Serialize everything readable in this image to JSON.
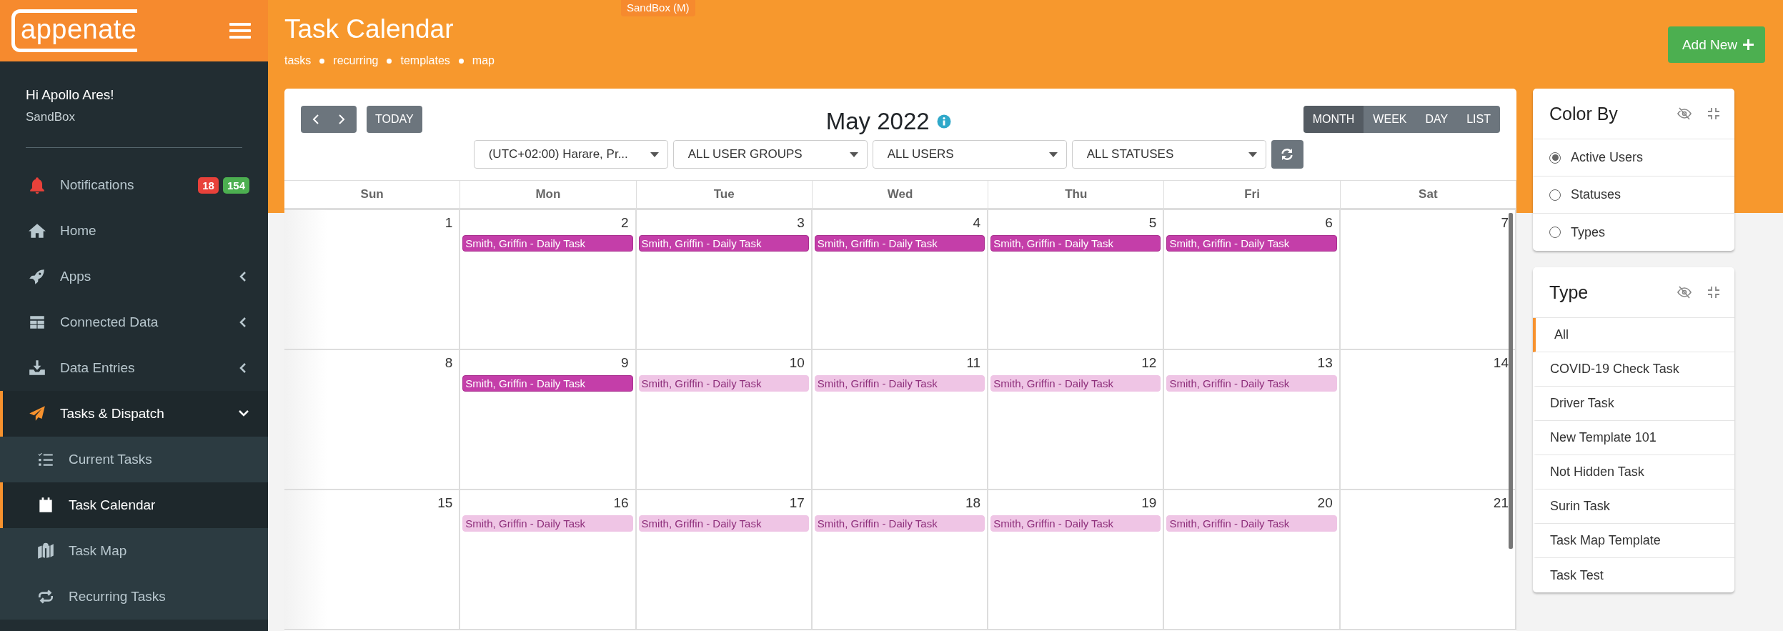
{
  "sandbox_badge": "SandBox (M)",
  "sidebar": {
    "logo": "appenate",
    "greeting": "Hi Apollo Ares!",
    "account": "SandBox",
    "items": [
      {
        "kind": "link",
        "label": "Notifications",
        "selected": false,
        "badges": [
          {
            "text": "18",
            "color": "#e8413a"
          },
          {
            "text": "154",
            "color": "#4caf50"
          }
        ]
      },
      {
        "kind": "link",
        "label": "Home",
        "selected": false
      },
      {
        "kind": "group",
        "label": "Apps",
        "selected": false,
        "expanded": false
      },
      {
        "kind": "group",
        "label": "Connected Data",
        "selected": false,
        "expanded": false
      },
      {
        "kind": "group",
        "label": "Data Entries",
        "selected": false,
        "expanded": false
      },
      {
        "kind": "group",
        "label": "Tasks & Dispatch",
        "selected": true,
        "expanded": true,
        "children": [
          {
            "label": "Current Tasks",
            "selected": false
          },
          {
            "label": "Task Calendar",
            "selected": true
          },
          {
            "label": "Task Map",
            "selected": false
          },
          {
            "label": "Recurring Tasks",
            "selected": false
          }
        ]
      }
    ]
  },
  "header": {
    "title": "Task Calendar",
    "links": [
      "tasks",
      "recurring",
      "templates",
      "map"
    ],
    "add_button": "Add New"
  },
  "calendar": {
    "today_button": "TODAY",
    "title": "May 2022",
    "views": [
      {
        "label": "MONTH",
        "selected": true
      },
      {
        "label": "WEEK",
        "selected": false
      },
      {
        "label": "DAY",
        "selected": false
      },
      {
        "label": "LIST",
        "selected": false
      }
    ],
    "filters": [
      {
        "value": "(UTC+02:00) Harare, Pr..."
      },
      {
        "value": "ALL USER GROUPS"
      },
      {
        "value": "ALL USERS"
      },
      {
        "value": "ALL STATUSES"
      }
    ],
    "weekdays": [
      "Sun",
      "Mon",
      "Tue",
      "Wed",
      "Thu",
      "Fri",
      "Sat"
    ],
    "weeks": [
      {
        "days": [
          {
            "number": "1"
          },
          {
            "number": "2",
            "events": [
              {
                "title": "Smith, Griffin - Daily Task",
                "dimmed": false
              }
            ]
          },
          {
            "number": "3",
            "events": [
              {
                "title": "Smith, Griffin - Daily Task",
                "dimmed": false
              }
            ]
          },
          {
            "number": "4",
            "events": [
              {
                "title": "Smith, Griffin - Daily Task",
                "dimmed": false
              }
            ]
          },
          {
            "number": "5",
            "events": [
              {
                "title": "Smith, Griffin - Daily Task",
                "dimmed": false
              }
            ]
          },
          {
            "number": "6",
            "events": [
              {
                "title": "Smith, Griffin - Daily Task",
                "dimmed": false
              }
            ]
          },
          {
            "number": "7"
          }
        ]
      },
      {
        "days": [
          {
            "number": "8"
          },
          {
            "number": "9",
            "events": [
              {
                "title": "Smith, Griffin - Daily Task",
                "dimmed": false
              }
            ]
          },
          {
            "number": "10",
            "events": [
              {
                "title": "Smith, Griffin - Daily Task",
                "dimmed": true
              }
            ]
          },
          {
            "number": "11",
            "events": [
              {
                "title": "Smith, Griffin - Daily Task",
                "dimmed": true
              }
            ]
          },
          {
            "number": "12",
            "events": [
              {
                "title": "Smith, Griffin - Daily Task",
                "dimmed": true
              }
            ]
          },
          {
            "number": "13",
            "events": [
              {
                "title": "Smith, Griffin - Daily Task",
                "dimmed": true
              }
            ]
          },
          {
            "number": "14"
          }
        ]
      },
      {
        "days": [
          {
            "number": "15"
          },
          {
            "number": "16",
            "events": [
              {
                "title": "Smith, Griffin - Daily Task",
                "dimmed": true
              }
            ]
          },
          {
            "number": "17",
            "events": [
              {
                "title": "Smith, Griffin - Daily Task",
                "dimmed": true
              }
            ]
          },
          {
            "number": "18",
            "events": [
              {
                "title": "Smith, Griffin - Daily Task",
                "dimmed": true
              }
            ]
          },
          {
            "number": "19",
            "events": [
              {
                "title": "Smith, Griffin - Daily Task",
                "dimmed": true
              }
            ]
          },
          {
            "number": "20",
            "events": [
              {
                "title": "Smith, Griffin - Daily Task",
                "dimmed": true
              }
            ]
          },
          {
            "number": "21"
          }
        ]
      }
    ]
  },
  "color_by": {
    "title": "Color By",
    "options": [
      {
        "label": "Active Users",
        "selected": true
      },
      {
        "label": "Statuses",
        "selected": false
      },
      {
        "label": "Types",
        "selected": false
      }
    ]
  },
  "type_filter": {
    "title": "Type",
    "items": [
      {
        "label": "All",
        "selected": true
      },
      {
        "label": "COVID-19 Check Task",
        "selected": false
      },
      {
        "label": "Driver Task",
        "selected": false
      },
      {
        "label": "New Template 101",
        "selected": false
      },
      {
        "label": "Not Hidden Task",
        "selected": false
      },
      {
        "label": "Surin Task",
        "selected": false
      },
      {
        "label": "Task Map Template",
        "selected": false
      },
      {
        "label": "Task Test",
        "selected": false
      }
    ]
  }
}
